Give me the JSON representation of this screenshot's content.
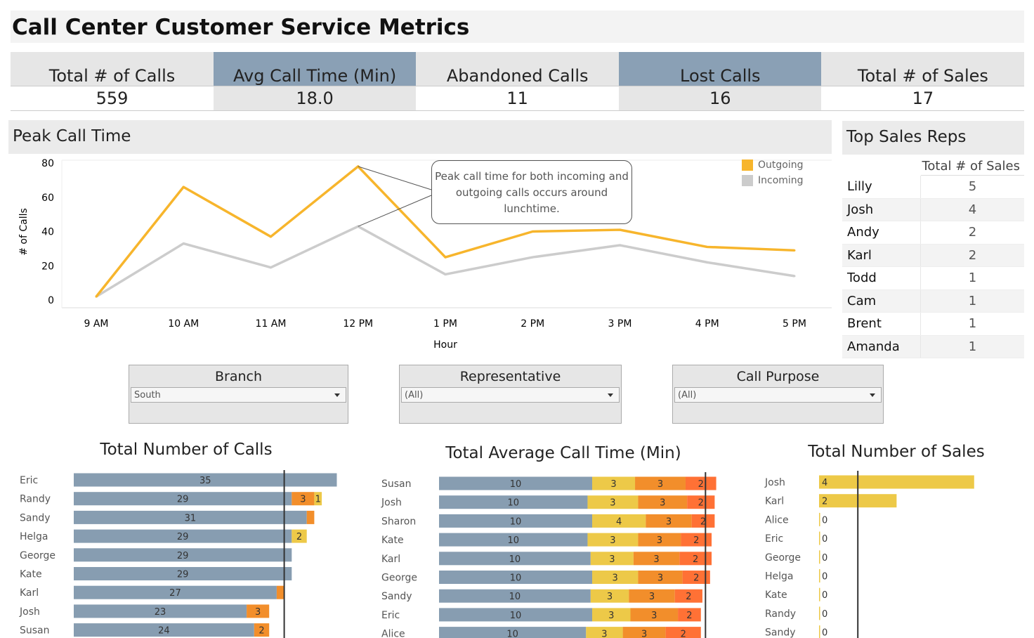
{
  "title": "Call Center Customer Service Metrics",
  "kpis": [
    {
      "label": "Total # of Calls",
      "value": "559"
    },
    {
      "label": "Avg Call Time (Min)",
      "value": "18.0"
    },
    {
      "label": "Abandoned Calls",
      "value": "11"
    },
    {
      "label": "Lost Calls",
      "value": "16"
    },
    {
      "label": "Total # of Sales",
      "value": "17"
    }
  ],
  "peak": {
    "title": "Peak Call Time",
    "annotation": "Peak call time for both incoming and outgoing calls occurs around lunchtime."
  },
  "top_reps": {
    "title": "Top Sales Reps",
    "column": "Total # of Sales",
    "rows": [
      {
        "name": "Lilly",
        "value": "5"
      },
      {
        "name": "Josh",
        "value": "4"
      },
      {
        "name": "Andy",
        "value": "2"
      },
      {
        "name": "Karl",
        "value": "2"
      },
      {
        "name": "Todd",
        "value": "1"
      },
      {
        "name": "Cam",
        "value": "1"
      },
      {
        "name": "Brent",
        "value": "1"
      },
      {
        "name": "Amanda",
        "value": "1"
      }
    ]
  },
  "filters": [
    {
      "label": "Branch",
      "value": "South"
    },
    {
      "label": "Representative",
      "value": "(All)"
    },
    {
      "label": "Call Purpose",
      "value": "(All)"
    }
  ],
  "colors": {
    "outgoing": "#f7b52c",
    "incoming": "#cccccc",
    "bar_base": "#879db1",
    "yellow": "#edc948",
    "orange": "#f28e2b",
    "red": "#ff7135"
  },
  "chart_data": [
    {
      "type": "line",
      "xlabel": "Hour",
      "ylabel": "# of Calls",
      "categories": [
        "9 AM",
        "10 AM",
        "11 AM",
        "12 PM",
        "1 PM",
        "2 PM",
        "3 PM",
        "4 PM",
        "5 PM"
      ],
      "yticks": [
        0,
        20,
        40,
        60,
        80
      ],
      "ylim": [
        0,
        80
      ],
      "legend": "top-right",
      "series": [
        {
          "name": "Outgoing",
          "color": "#f7b52c",
          "values": [
            2,
            66,
            37,
            78,
            25,
            40,
            41,
            31,
            29
          ]
        },
        {
          "name": "Incoming",
          "color": "#cccccc",
          "values": [
            2,
            33,
            19,
            43,
            15,
            25,
            32,
            22,
            14
          ]
        }
      ]
    },
    {
      "type": "bar",
      "title": "Total Number of Calls",
      "reference_line": 28,
      "categories": [
        "Eric",
        "Randy",
        "Sandy",
        "Helga",
        "George",
        "Kate",
        "Karl",
        "Josh",
        "Susan"
      ],
      "segments": [
        [
          {
            "v": 35,
            "c": "bar_base",
            "l": "35"
          }
        ],
        [
          {
            "v": 29,
            "c": "bar_base",
            "l": "29"
          },
          {
            "v": 3,
            "c": "orange",
            "l": "3"
          },
          {
            "v": 1,
            "c": "yellow",
            "l": "1"
          }
        ],
        [
          {
            "v": 31,
            "c": "bar_base",
            "l": "31"
          },
          {
            "v": 1,
            "c": "orange",
            "l": ""
          }
        ],
        [
          {
            "v": 29,
            "c": "bar_base",
            "l": "29"
          },
          {
            "v": 2,
            "c": "yellow",
            "l": "2"
          }
        ],
        [
          {
            "v": 29,
            "c": "bar_base",
            "l": "29"
          }
        ],
        [
          {
            "v": 29,
            "c": "bar_base",
            "l": "29"
          }
        ],
        [
          {
            "v": 27,
            "c": "bar_base",
            "l": "27"
          },
          {
            "v": 1,
            "c": "orange",
            "l": ""
          }
        ],
        [
          {
            "v": 23,
            "c": "bar_base",
            "l": "23"
          },
          {
            "v": 3,
            "c": "orange",
            "l": "3"
          }
        ],
        [
          {
            "v": 24,
            "c": "bar_base",
            "l": "24"
          },
          {
            "v": 2,
            "c": "orange",
            "l": "2"
          }
        ]
      ]
    },
    {
      "type": "bar",
      "title": "Total Average Call Time (Min)",
      "reference_line": 17.4,
      "categories": [
        "Susan",
        "Josh",
        "Sharon",
        "Kate",
        "Karl",
        "George",
        "Sandy",
        "Eric",
        "Alice"
      ],
      "segments": [
        [
          {
            "v": 10,
            "c": "bar_base",
            "l": "10"
          },
          {
            "v": 2.8,
            "c": "yellow",
            "l": "3"
          },
          {
            "v": 3.3,
            "c": "orange",
            "l": "3"
          },
          {
            "v": 2.0,
            "c": "red",
            "l": "2"
          }
        ],
        [
          {
            "v": 9.7,
            "c": "bar_base",
            "l": "10"
          },
          {
            "v": 3.3,
            "c": "yellow",
            "l": "3"
          },
          {
            "v": 3.2,
            "c": "orange",
            "l": "3"
          },
          {
            "v": 1.8,
            "c": "red",
            "l": "2"
          }
        ],
        [
          {
            "v": 10,
            "c": "bar_base",
            "l": "10"
          },
          {
            "v": 3.5,
            "c": "yellow",
            "l": "4"
          },
          {
            "v": 3.0,
            "c": "orange",
            "l": "3"
          },
          {
            "v": 1.5,
            "c": "red",
            "l": "2"
          }
        ],
        [
          {
            "v": 9.7,
            "c": "bar_base",
            "l": "10"
          },
          {
            "v": 3.3,
            "c": "yellow",
            "l": "3"
          },
          {
            "v": 2.8,
            "c": "orange",
            "l": "3"
          },
          {
            "v": 2.0,
            "c": "red",
            "l": "2"
          }
        ],
        [
          {
            "v": 9.9,
            "c": "bar_base",
            "l": "10"
          },
          {
            "v": 2.8,
            "c": "yellow",
            "l": "3"
          },
          {
            "v": 3.0,
            "c": "orange",
            "l": "3"
          },
          {
            "v": 2.1,
            "c": "red",
            "l": "2"
          }
        ],
        [
          {
            "v": 10,
            "c": "bar_base",
            "l": "10"
          },
          {
            "v": 3.0,
            "c": "yellow",
            "l": "3"
          },
          {
            "v": 2.9,
            "c": "orange",
            "l": "3"
          },
          {
            "v": 1.8,
            "c": "red",
            "l": "2"
          }
        ],
        [
          {
            "v": 9.9,
            "c": "bar_base",
            "l": "10"
          },
          {
            "v": 2.5,
            "c": "yellow",
            "l": "3"
          },
          {
            "v": 3.0,
            "c": "orange",
            "l": "3"
          },
          {
            "v": 1.8,
            "c": "red",
            "l": "2"
          }
        ],
        [
          {
            "v": 10,
            "c": "bar_base",
            "l": "10"
          },
          {
            "v": 2.5,
            "c": "yellow",
            "l": "3"
          },
          {
            "v": 3.1,
            "c": "orange",
            "l": "3"
          },
          {
            "v": 1.5,
            "c": "red",
            "l": "2"
          }
        ],
        [
          {
            "v": 9.6,
            "c": "bar_base",
            "l": "10"
          },
          {
            "v": 2.4,
            "c": "yellow",
            "l": "3"
          },
          {
            "v": 2.8,
            "c": "orange",
            "l": "3"
          },
          {
            "v": 2.3,
            "c": "red",
            "l": "2"
          }
        ]
      ]
    },
    {
      "type": "bar",
      "title": "Total Number of Sales",
      "reference_line": 1.0,
      "categories": [
        "Josh",
        "Karl",
        "Alice",
        "Eric",
        "George",
        "Helga",
        "Kate",
        "Randy",
        "Sandy"
      ],
      "values": [
        4,
        2,
        0,
        0,
        0,
        0,
        0,
        0,
        0
      ]
    }
  ]
}
